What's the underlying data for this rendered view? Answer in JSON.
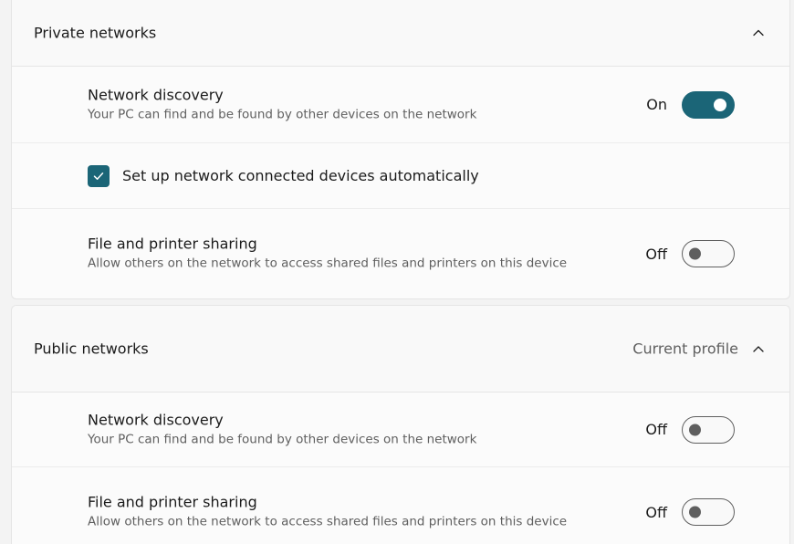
{
  "private": {
    "title": "Private networks",
    "network_discovery": {
      "title": "Network discovery",
      "description": "Your PC can find and be found by other devices on the network",
      "state": "On"
    },
    "auto_setup": {
      "label": "Set up network connected devices automatically",
      "checked": true
    },
    "file_sharing": {
      "title": "File and printer sharing",
      "description": "Allow others on the network to access shared files and printers on this device",
      "state": "Off"
    }
  },
  "public": {
    "title": "Public networks",
    "current_profile": "Current profile",
    "network_discovery": {
      "title": "Network discovery",
      "description": "Your PC can find and be found by other devices on the network",
      "state": "Off"
    },
    "file_sharing": {
      "title": "File and printer sharing",
      "description": "Allow others on the network to access shared files and printers on this device",
      "state": "Off"
    }
  },
  "icons": {
    "collapse": "chevron-up-icon",
    "check": "checkmark-icon"
  },
  "colors": {
    "accent": "#1b6577",
    "toggle_off_border": "#5f5f5f"
  }
}
